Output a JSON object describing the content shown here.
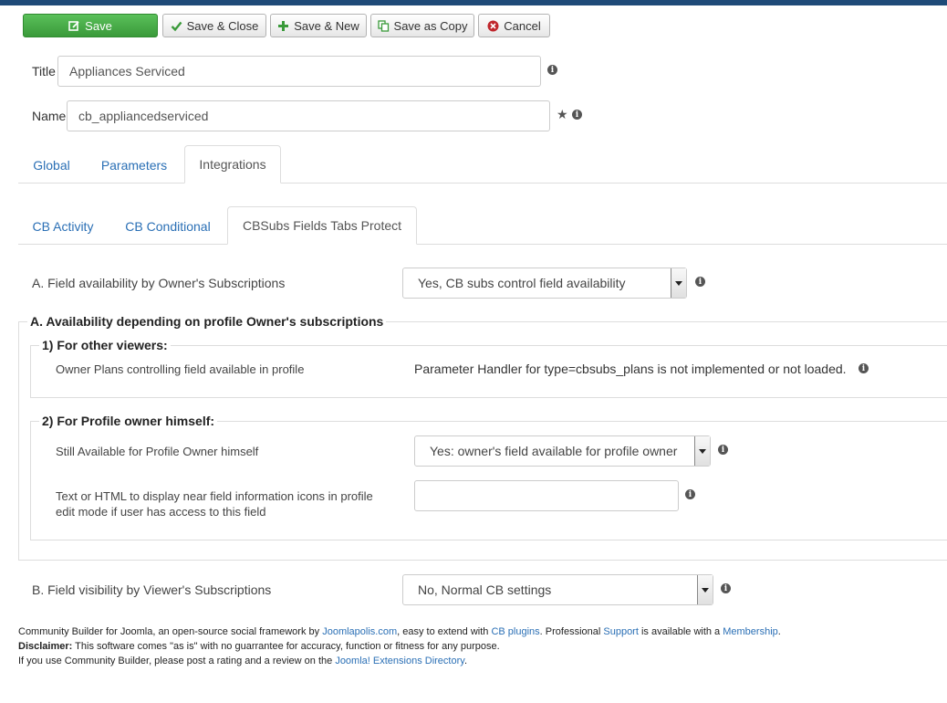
{
  "toolbar": {
    "save": "Save",
    "save_close": "Save & Close",
    "save_new": "Save & New",
    "save_copy": "Save as Copy",
    "cancel": "Cancel"
  },
  "fields": {
    "title_label": "Title",
    "title_value": "Appliances Serviced",
    "name_label": "Name",
    "name_value": "cb_appliancedserviced"
  },
  "tabs": [
    "Global",
    "Parameters",
    "Integrations"
  ],
  "subtabs": [
    "CB Activity",
    "CB Conditional",
    "CBSubs Fields Tabs Protect"
  ],
  "section_a": {
    "label": "A. Field availability by Owner's Subscriptions",
    "select_value": "Yes, CB subs control field availability",
    "legend": "A. Availability depending on profile Owner's subscriptions",
    "other_viewers": {
      "legend": "1) For other viewers:",
      "label": "Owner Plans controlling field available in profile",
      "value": "Parameter Handler for type=cbsubs_plans is not implemented or not loaded."
    },
    "owner_himself": {
      "legend": "2) For Profile owner himself:",
      "still_label": "Still Available for Profile Owner himself",
      "still_value": "Yes: owner's field available for profile owner",
      "text_label_1": "Text or HTML to display near field information icons in profile",
      "text_label_2": "edit mode if user has access to this field",
      "text_value": ""
    }
  },
  "section_b": {
    "label": "B. Field visibility by Viewer's Subscriptions",
    "select_value": "No, Normal CB settings"
  },
  "footer": {
    "l1_a": "Community Builder for Joomla, an open-source social framework by ",
    "l1_link1": "Joomlapolis.com",
    "l1_b": ", easy to extend with ",
    "l1_link2": "CB plugins",
    "l1_c": ". Professional ",
    "l1_link3": "Support",
    "l1_d": " is available with a ",
    "l1_link4": "Membership",
    "l1_e": ".",
    "l2_bold": "Disclaimer:",
    "l2_text": " This software comes \"as is\" with no guarrantee for accuracy, function or fitness for any purpose.",
    "l3_a": "If you use Community Builder, please post a rating and a review on the ",
    "l3_link": "Joomla! Extensions Directory",
    "l3_b": "."
  }
}
